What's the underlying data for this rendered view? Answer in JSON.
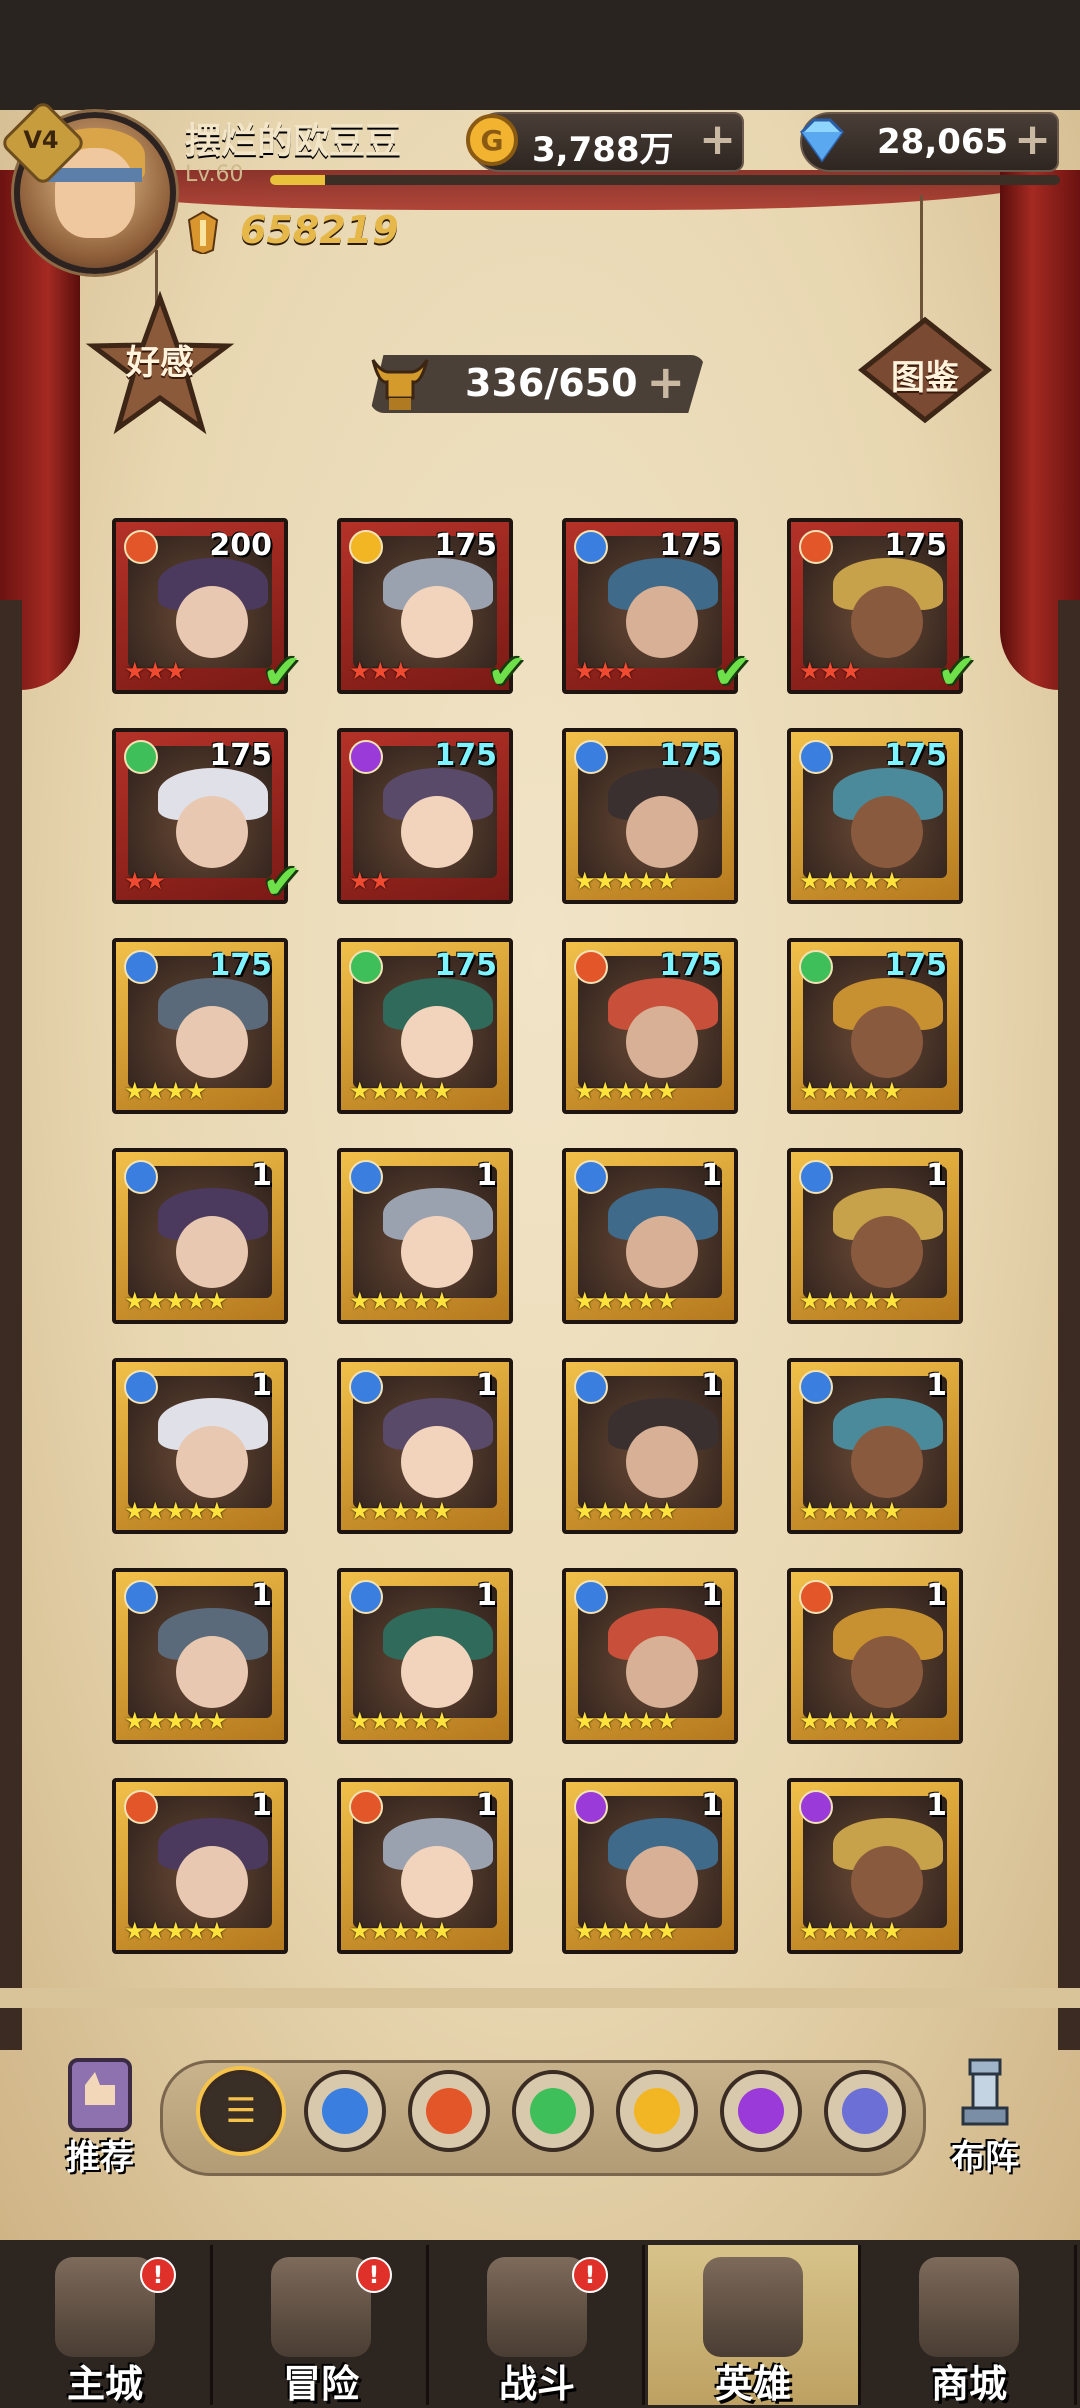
{
  "player": {
    "vip": "V4",
    "name": "摆烂的欧豆豆",
    "level": "Lv.60",
    "xp_progress": 0.07,
    "power": "658219"
  },
  "resources": {
    "gold": "3,788万",
    "diamonds": "28,065",
    "plus": "+"
  },
  "buttons": {
    "favor": "好感",
    "codex": "图鉴",
    "recommend": "推荐",
    "formation": "布阵"
  },
  "capacity": "336/650",
  "heroes": [
    {
      "level": "200",
      "frame": "red",
      "element": "fire",
      "stars": "★★★",
      "checked": true
    },
    {
      "level": "175",
      "frame": "red",
      "element": "light",
      "stars": "★★★",
      "checked": true
    },
    {
      "level": "175",
      "frame": "red",
      "element": "water",
      "stars": "★★★",
      "checked": true
    },
    {
      "level": "175",
      "frame": "red",
      "element": "fire",
      "stars": "★★★",
      "checked": true
    },
    {
      "level": "175",
      "frame": "red",
      "element": "wind",
      "stars": "★★",
      "checked": true
    },
    {
      "level": "175",
      "frame": "red",
      "element": "dark",
      "stars": "★★",
      "checked": false
    },
    {
      "level": "175",
      "frame": "gold",
      "element": "water",
      "stars": "★★★★★",
      "checked": false
    },
    {
      "level": "175",
      "frame": "gold",
      "element": "water",
      "stars": "★★★★★",
      "checked": false
    },
    {
      "level": "175",
      "frame": "gold",
      "element": "water",
      "stars": "★★★★",
      "checked": false
    },
    {
      "level": "175",
      "frame": "gold",
      "element": "wind",
      "stars": "★★★★★",
      "checked": false
    },
    {
      "level": "175",
      "frame": "gold",
      "element": "fire",
      "stars": "★★★★★",
      "checked": false
    },
    {
      "level": "175",
      "frame": "gold",
      "element": "wind",
      "stars": "★★★★★",
      "checked": false
    },
    {
      "level": "1",
      "frame": "gold",
      "element": "water",
      "stars": "★★★★★",
      "checked": false
    },
    {
      "level": "1",
      "frame": "gold",
      "element": "water",
      "stars": "★★★★★",
      "checked": false
    },
    {
      "level": "1",
      "frame": "gold",
      "element": "water",
      "stars": "★★★★★",
      "checked": false
    },
    {
      "level": "1",
      "frame": "gold",
      "element": "water",
      "stars": "★★★★★",
      "checked": false
    },
    {
      "level": "1",
      "frame": "gold",
      "element": "water",
      "stars": "★★★★★",
      "checked": false
    },
    {
      "level": "1",
      "frame": "gold",
      "element": "water",
      "stars": "★★★★★",
      "checked": false
    },
    {
      "level": "1",
      "frame": "gold",
      "element": "water",
      "stars": "★★★★★",
      "checked": false
    },
    {
      "level": "1",
      "frame": "gold",
      "element": "water",
      "stars": "★★★★★",
      "checked": false
    },
    {
      "level": "1",
      "frame": "gold",
      "element": "water",
      "stars": "★★★★★",
      "checked": false
    },
    {
      "level": "1",
      "frame": "gold",
      "element": "water",
      "stars": "★★★★★",
      "checked": false
    },
    {
      "level": "1",
      "frame": "gold",
      "element": "water",
      "stars": "★★★★★",
      "checked": false
    },
    {
      "level": "1",
      "frame": "gold",
      "element": "fire",
      "stars": "★★★★★",
      "checked": false
    },
    {
      "level": "1",
      "frame": "gold",
      "element": "fire",
      "stars": "★★★★★",
      "checked": false
    },
    {
      "level": "1",
      "frame": "gold",
      "element": "fire",
      "stars": "★★★★★",
      "checked": false
    },
    {
      "level": "1",
      "frame": "gold",
      "element": "dark",
      "stars": "★★★★★",
      "checked": false
    },
    {
      "level": "1",
      "frame": "gold",
      "element": "dark",
      "stars": "★★★★★",
      "checked": false
    }
  ],
  "filters": [
    "all",
    "water",
    "fire",
    "wind",
    "light",
    "dark",
    "void"
  ],
  "nav": [
    {
      "label": "主城",
      "alert": "!"
    },
    {
      "label": "冒险",
      "alert": "!"
    },
    {
      "label": "战斗",
      "alert": "!"
    },
    {
      "label": "英雄",
      "alert": ""
    },
    {
      "label": "商城",
      "alert": ""
    }
  ],
  "colors": {
    "water": "#3a7fe0",
    "fire": "#e2562a",
    "wind": "#3fbf59",
    "light": "#f2b624",
    "dark": "#9a3ad9",
    "void": "#6b6fd6",
    "all": "#3a2f26"
  }
}
